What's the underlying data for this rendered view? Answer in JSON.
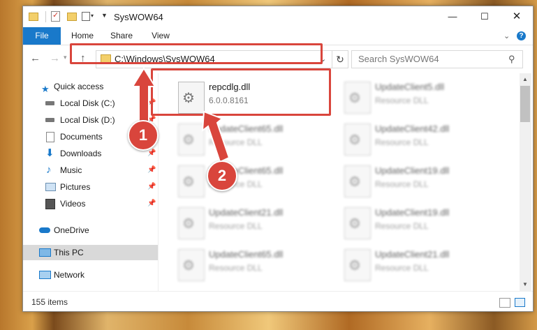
{
  "window": {
    "title": "SysWOW64",
    "controls": {
      "minimize": "—",
      "maximize": "☐",
      "close": "✕"
    }
  },
  "ribbon": {
    "tabs": [
      "File",
      "Home",
      "Share",
      "View"
    ],
    "help": "?"
  },
  "nav": {
    "address": "C:\\Windows\\SysWOW64",
    "search_placeholder": "Search SysWOW64"
  },
  "sidebar": {
    "items": [
      {
        "label": "Quick access",
        "icon": "star-icon",
        "pinned": false
      },
      {
        "label": "Local Disk (C:)",
        "icon": "drive-icon",
        "pinned": true
      },
      {
        "label": "Local Disk (D:)",
        "icon": "drive-icon",
        "pinned": true
      },
      {
        "label": "Documents",
        "icon": "documents-icon",
        "pinned": true
      },
      {
        "label": "Downloads",
        "icon": "downloads-icon",
        "pinned": true
      },
      {
        "label": "Music",
        "icon": "music-icon",
        "pinned": true
      },
      {
        "label": "Pictures",
        "icon": "pictures-icon",
        "pinned": true
      },
      {
        "label": "Videos",
        "icon": "videos-icon",
        "pinned": true
      },
      {
        "label": "OneDrive",
        "icon": "onedrive-icon",
        "pinned": false
      },
      {
        "label": "This PC",
        "icon": "pc-icon",
        "pinned": false,
        "selected": true
      },
      {
        "label": "Network",
        "icon": "network-icon",
        "pinned": false
      }
    ]
  },
  "files": [
    {
      "name": "repcdlg.dll",
      "sub": "6.0.0.8161",
      "highlighted": true
    },
    {
      "name": "UpdateClient5.dll",
      "sub": "Resource DLL"
    },
    {
      "name": "UpdateClient65.dll",
      "sub": "Resource DLL"
    },
    {
      "name": "UpdateClient42.dll",
      "sub": "Resource DLL"
    },
    {
      "name": "UpdateClient65.dll",
      "sub": "Resource DLL"
    },
    {
      "name": "UpdateClient19.dll",
      "sub": "Resource DLL"
    },
    {
      "name": "UpdateClient21.dll",
      "sub": "Resource DLL"
    },
    {
      "name": "UpdateClient19.dll",
      "sub": "Resource DLL"
    },
    {
      "name": "UpdateClient65.dll",
      "sub": "Resource DLL"
    },
    {
      "name": "UpdateClient21.dll",
      "sub": "Resource DLL"
    }
  ],
  "status": {
    "items_count": "155 items"
  },
  "callouts": [
    "1",
    "2"
  ],
  "colors": {
    "accent": "#1979ca",
    "callout": "#d9453c"
  }
}
